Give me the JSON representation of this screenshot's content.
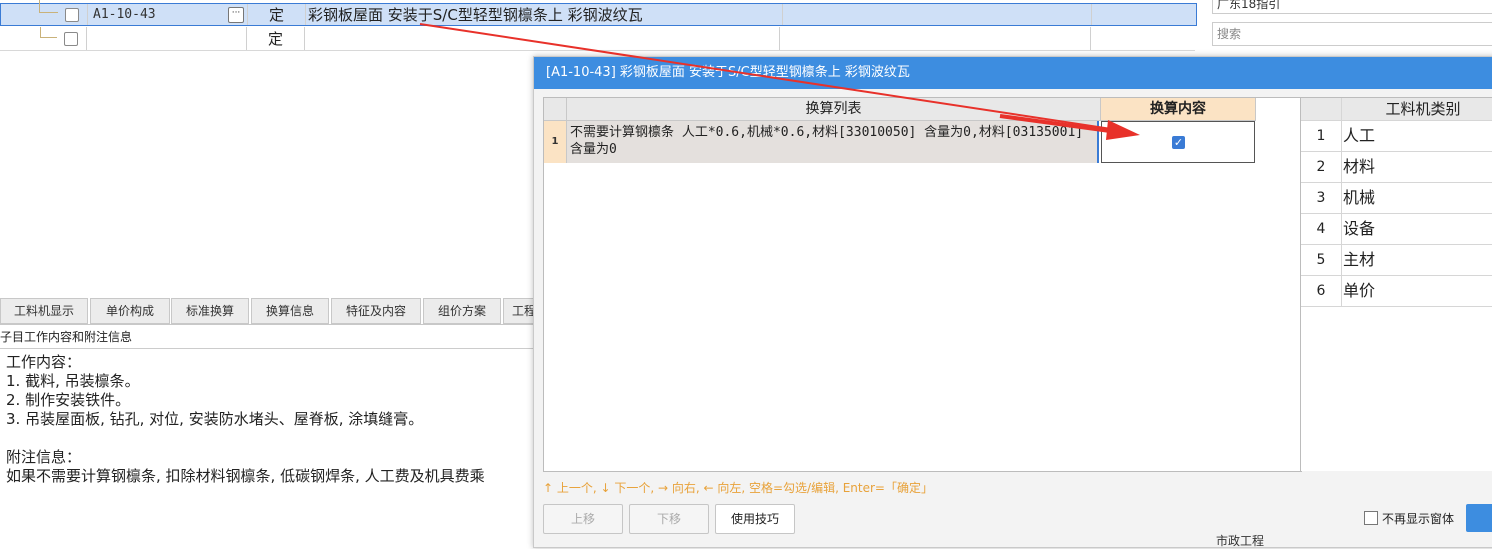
{
  "top_grid": {
    "rows": [
      {
        "code": "A1-10-43",
        "type": "定",
        "name": "彩钢板屋面 安装于S/C型轻型钢檩条上 彩钢波纹瓦"
      },
      {
        "code": "",
        "type": "定",
        "name": ""
      }
    ]
  },
  "top_right": {
    "field1": "广东18指引",
    "search_placeholder": "搜索"
  },
  "bottom_tabs": [
    "工料机显示",
    "单价构成",
    "标准换算",
    "换算信息",
    "特征及内容",
    "组价方案",
    "工程"
  ],
  "sub_title": "子目工作内容和附注信息",
  "work_content": {
    "lines": [
      "工作内容：",
      "1. 截料, 吊装檩条。",
      "2. 制作安装铁件。",
      "3. 吊装屋面板, 钻孔, 对位, 安装防水堵头、屋脊板, 涂填缝膏。"
    ],
    "note_title": "附注信息：",
    "note_text": "如果不需要计算钢檩条, 扣除材料钢檩条, 低碳钢焊条, 人工费及机具费乘"
  },
  "dialog": {
    "title": "[A1-10-43] 彩钢板屋面 安装于S/C型轻型钢檩条上 彩钢波纹瓦",
    "col_list": "换算列表",
    "col_content": "换算内容",
    "rows": [
      {
        "num": "1",
        "text": "不需要计算钢檩条 人工*0.6,机械*0.6,材料[33010050] 含量为0,材料[03135001] 含量为0",
        "checked": true
      }
    ],
    "category_header": "工料机类别",
    "categories": [
      {
        "num": "1",
        "name": "人工"
      },
      {
        "num": "2",
        "name": "材料"
      },
      {
        "num": "3",
        "name": "机械"
      },
      {
        "num": "4",
        "name": "设备"
      },
      {
        "num": "5",
        "name": "主材"
      },
      {
        "num": "6",
        "name": "单价"
      }
    ],
    "hint": "↑ 上一个, ↓ 下一个, → 向右, ← 向左, 空格=勾选/编辑, Enter=「确定」",
    "btn_up": "上移",
    "btn_down": "下移",
    "btn_tips": "使用技巧",
    "no_show_label": "不再显示窗体"
  },
  "bottom_right_text": "市政工程",
  "colors": {
    "accent": "#3d8de0",
    "arrow": "#e8312a",
    "header_highlight": "#fbe3c4"
  }
}
